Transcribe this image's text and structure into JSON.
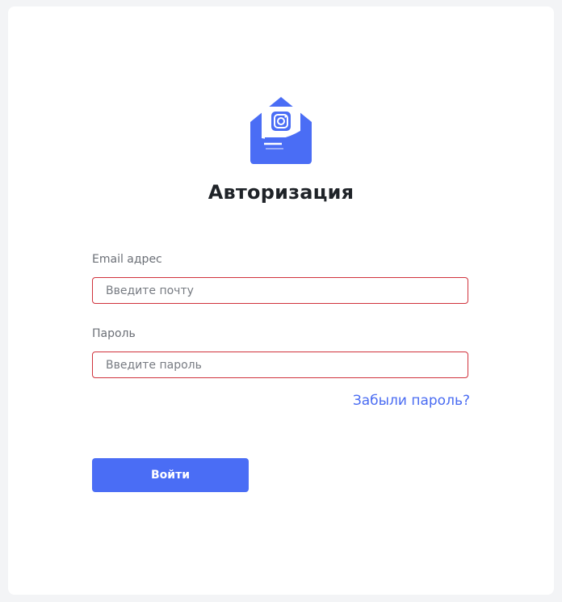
{
  "form": {
    "logo_icon": "envelope-instagram-icon",
    "title": "Авторизация",
    "email_label": "Email адрес",
    "email_placeholder": "Введите почту",
    "email_value": "",
    "password_label": "Пароль",
    "password_placeholder": "Введите пароль",
    "password_value": "",
    "forgot_link": "Забыли пароль?",
    "submit_label": "Войти"
  },
  "colors": {
    "accent": "#4a6df5",
    "error_border": "#d0323c",
    "title": "#1f2328",
    "label": "#6b6f76"
  }
}
